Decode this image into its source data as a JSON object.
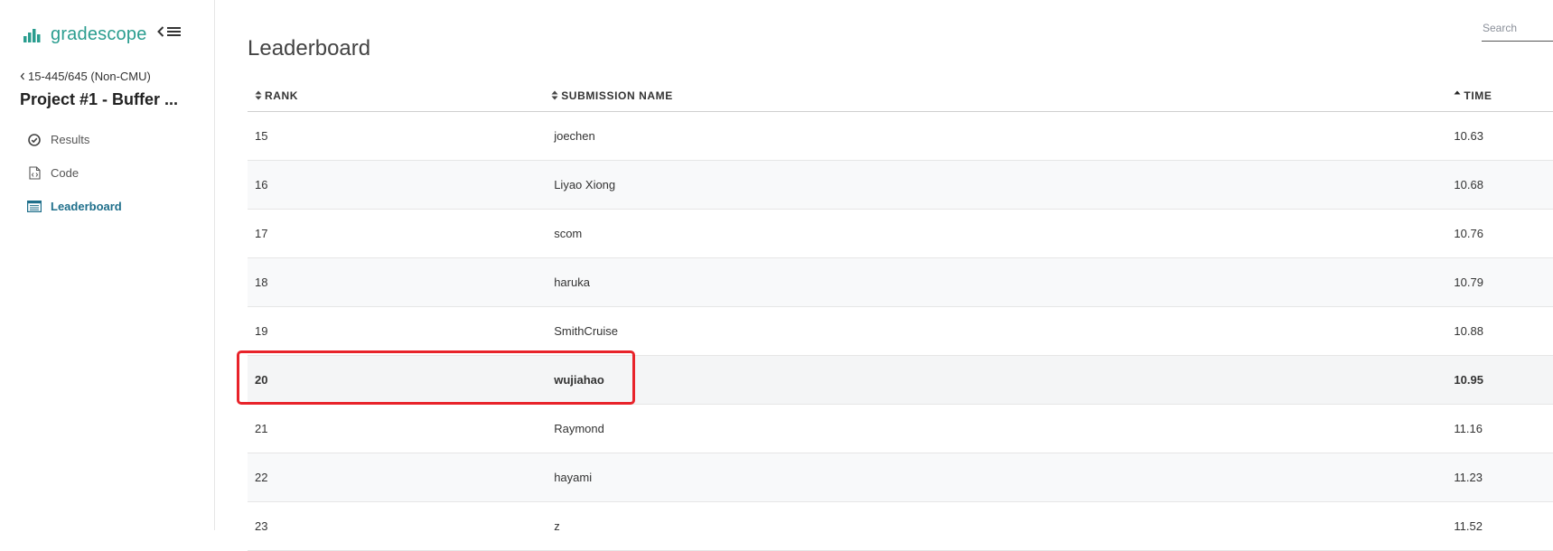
{
  "brand": {
    "name": "gradescope",
    "accent": "#2a9d8f"
  },
  "sidebar": {
    "course_link": "15-445/645 (Non-CMU)",
    "assignment_title": "Project #1 - Buffer ...",
    "items": [
      {
        "label": "Results",
        "icon": "check-circle-icon",
        "active": false
      },
      {
        "label": "Code",
        "icon": "code-file-icon",
        "active": false
      },
      {
        "label": "Leaderboard",
        "icon": "leaderboard-list-icon",
        "active": true
      }
    ]
  },
  "main": {
    "title": "Leaderboard",
    "search_placeholder": "Search"
  },
  "table": {
    "headers": {
      "rank": "RANK",
      "name": "SUBMISSION NAME",
      "time": "TIME"
    },
    "sorted_by": "time",
    "rows": [
      {
        "rank": "15",
        "name": "joechen",
        "time": "10.63"
      },
      {
        "rank": "16",
        "name": "Liyao Xiong",
        "time": "10.68"
      },
      {
        "rank": "17",
        "name": "scom",
        "time": "10.76"
      },
      {
        "rank": "18",
        "name": "haruka",
        "time": "10.79"
      },
      {
        "rank": "19",
        "name": "SmithCruise",
        "time": "10.88"
      },
      {
        "rank": "20",
        "name": "wujiahao",
        "time": "10.95"
      },
      {
        "rank": "21",
        "name": "Raymond",
        "time": "11.16"
      },
      {
        "rank": "22",
        "name": "hayami",
        "time": "11.23"
      },
      {
        "rank": "23",
        "name": "z",
        "time": "11.52"
      }
    ],
    "highlight_color": "#e8232a"
  }
}
